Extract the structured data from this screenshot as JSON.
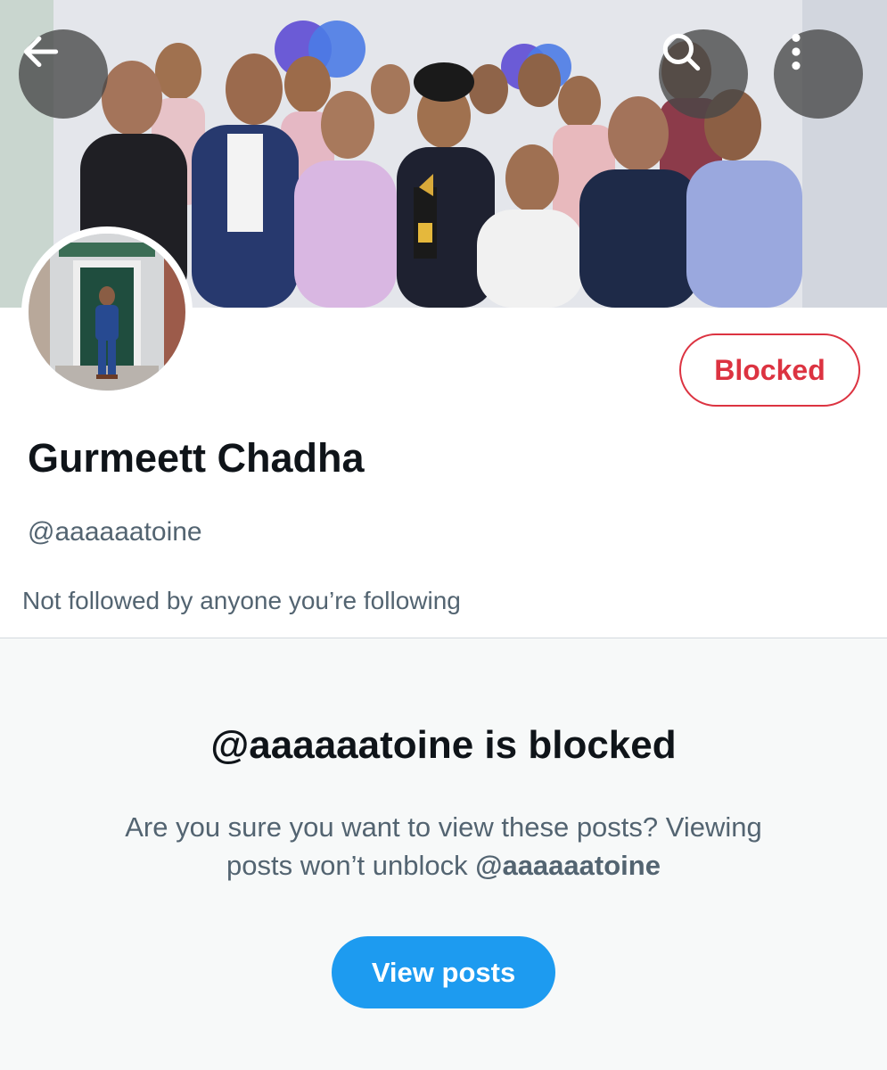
{
  "header": {
    "back_icon": "arrow-left-icon",
    "search_icon": "search-icon",
    "more_icon": "more-vertical-icon"
  },
  "profile": {
    "display_name": "Gurmeett Chadha",
    "handle": "@aaaaaatoine",
    "followed_note": "Not followed by anyone you’re following",
    "blocked_label": "Blocked"
  },
  "blocked_notice": {
    "title": "@aaaaaatoine is blocked",
    "body_text": "Are you sure you want to view these posts? Viewing posts won’t unblock",
    "body_handle": "@aaaaaatoine",
    "view_button_label": "View posts"
  },
  "colors": {
    "accent_blue": "#1d9bf0",
    "blocked_red": "#dc3341",
    "text_primary": "#0f1419",
    "text_secondary": "#536471"
  }
}
